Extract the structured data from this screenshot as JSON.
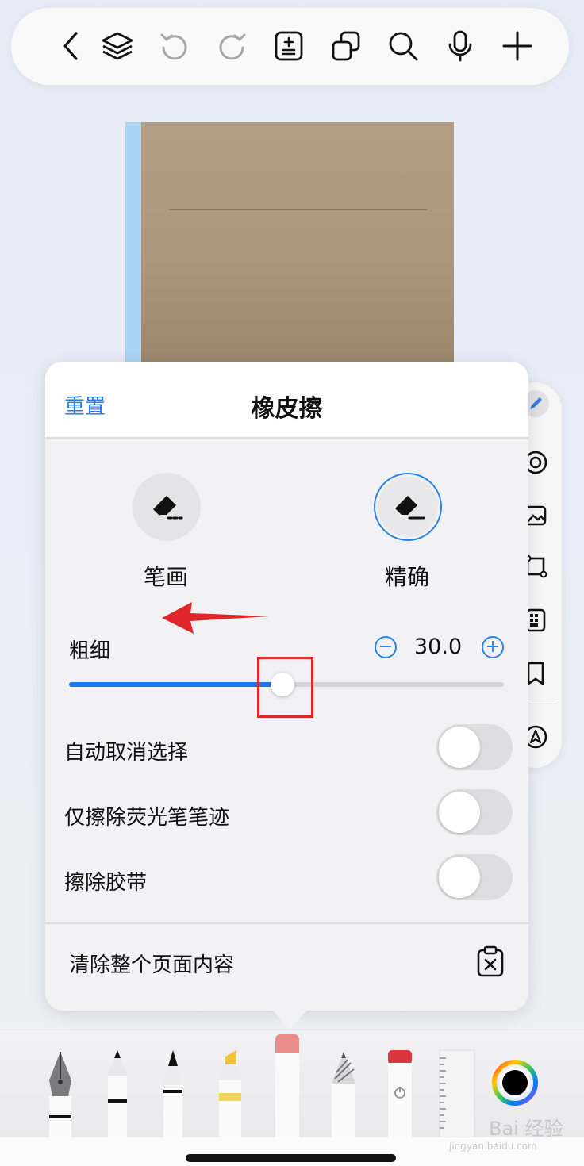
{
  "toolbar": {
    "icons": [
      "back-icon",
      "layers-icon",
      "undo-icon",
      "redo-icon",
      "page-add-icon",
      "copy-icon",
      "search-icon",
      "microphone-icon",
      "plus-icon"
    ]
  },
  "side_rail": {
    "icons": [
      "pen-icon",
      "lasso-icon",
      "image-icon",
      "shape-icon",
      "keyboard-icon",
      "bookmark-icon",
      "navigation-icon"
    ]
  },
  "eraser_panel": {
    "reset_label": "重置",
    "title": "橡皮擦",
    "modes": [
      {
        "label": "笔画",
        "icon": "eraser-stroke-icon",
        "selected": false
      },
      {
        "label": "精确",
        "icon": "eraser-precise-icon",
        "selected": true
      }
    ],
    "thickness": {
      "label": "粗细",
      "value": "30.0",
      "minus": "−",
      "plus": "+",
      "fraction": 0.49
    },
    "toggles": [
      {
        "label": "自动取消选择",
        "on": false
      },
      {
        "label": "仅擦除荧光笔笔迹",
        "on": false
      },
      {
        "label": "擦除胶带",
        "on": false
      }
    ],
    "clear_label": "清除整个页面内容"
  },
  "tray": {
    "tools": [
      "fountain-pen",
      "ballpoint-pen",
      "brush-pen",
      "highlighter",
      "eraser",
      "pencil",
      "tape",
      "ruler",
      "color-picker"
    ],
    "selected_tool": "eraser",
    "selected_color": "#000000"
  },
  "colors": {
    "accent": "#2a7ee6",
    "slider_fill": "#1a7af0",
    "annotation": "#e0262a"
  },
  "watermark": {
    "text": "Bai 经验",
    "sub": "jingyan.baidu.com"
  }
}
